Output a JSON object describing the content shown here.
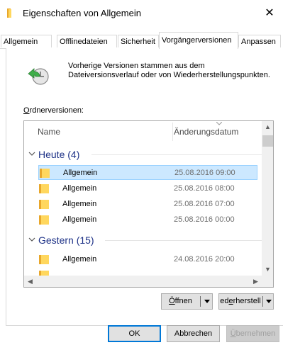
{
  "window": {
    "title": "Eigenschaften von Allgemein",
    "close_glyph": "✕"
  },
  "tabs": [
    {
      "label": "Allgemein",
      "active": false
    },
    {
      "label": "Offlinedateien",
      "active": false
    },
    {
      "label": "Sicherheit",
      "active": false
    },
    {
      "label": "Vorgängerversionen",
      "active": true
    },
    {
      "label": "Anpassen",
      "active": false
    }
  ],
  "description": {
    "line1": "Vorherige Versionen stammen aus dem",
    "line2": "Dateiversionsverlauf oder von Wiederherstellungspunkten."
  },
  "folder_versions_label": "Ordnerversionen:",
  "list": {
    "columns": {
      "name": "Name",
      "date": "Änderungsdatum"
    },
    "groups": [
      {
        "label": "Heute (4)",
        "rows": [
          {
            "name": "Allgemein",
            "date": "25.08.2016 09:00",
            "selected": true
          },
          {
            "name": "Allgemein",
            "date": "25.08.2016 08:00",
            "selected": false
          },
          {
            "name": "Allgemein",
            "date": "25.08.2016 07:00",
            "selected": false
          },
          {
            "name": "Allgemein",
            "date": "25.08.2016 00:00",
            "selected": false
          }
        ]
      },
      {
        "label": "Gestern (15)",
        "rows": [
          {
            "name": "Allgemein",
            "date": "24.08.2016 20:00",
            "selected": false
          }
        ]
      }
    ]
  },
  "action_buttons": {
    "open": "Öffnen",
    "restore": "ederherstell"
  },
  "dialog_buttons": {
    "ok": "OK",
    "cancel": "Abbrechen",
    "apply": "Übernehmen"
  },
  "colors": {
    "accent": "#0078d7",
    "selection": "#cce8ff",
    "group_text": "#1e3287",
    "folder_yellow": "#ffd75e"
  }
}
